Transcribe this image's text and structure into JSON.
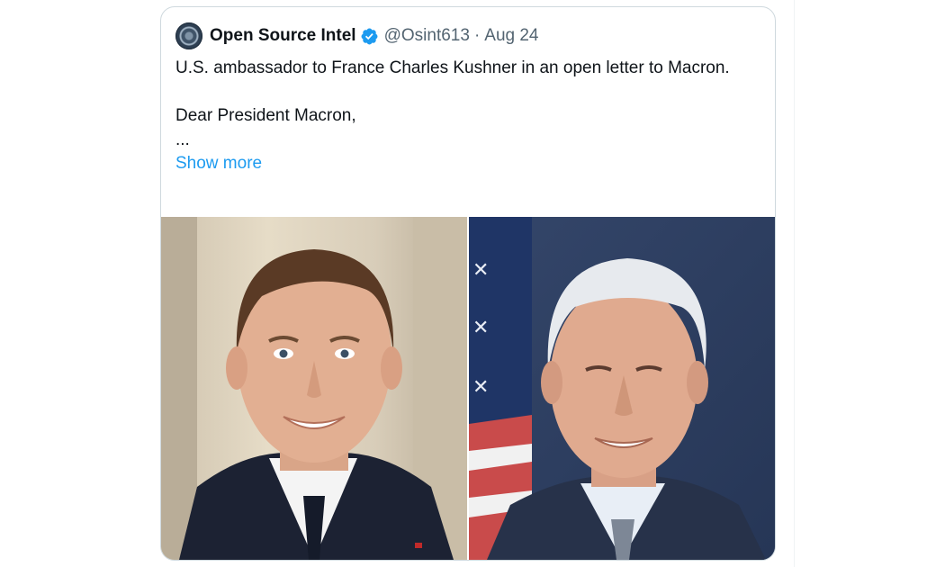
{
  "tweet": {
    "author": {
      "display_name": "Open Source Intel",
      "handle": "@Osint613",
      "verified": true,
      "avatar_icon": "osint-seal-avatar"
    },
    "separator": "·",
    "date": "Aug 24",
    "text_lines": [
      "U.S. ambassador to France Charles Kushner in an open letter to Macron.",
      "Dear President Macron,",
      "..."
    ],
    "show_more_label": "Show more",
    "media": [
      {
        "description_icon": "photo-man-smiling-dark-suit"
      },
      {
        "description_icon": "photo-white-haired-man-flag-background"
      }
    ]
  },
  "colors": {
    "link": "#1d9bf0",
    "verified_badge": "#1d9bf0",
    "text": "#0f1419",
    "muted": "#536471",
    "border": "#cfd9de"
  }
}
